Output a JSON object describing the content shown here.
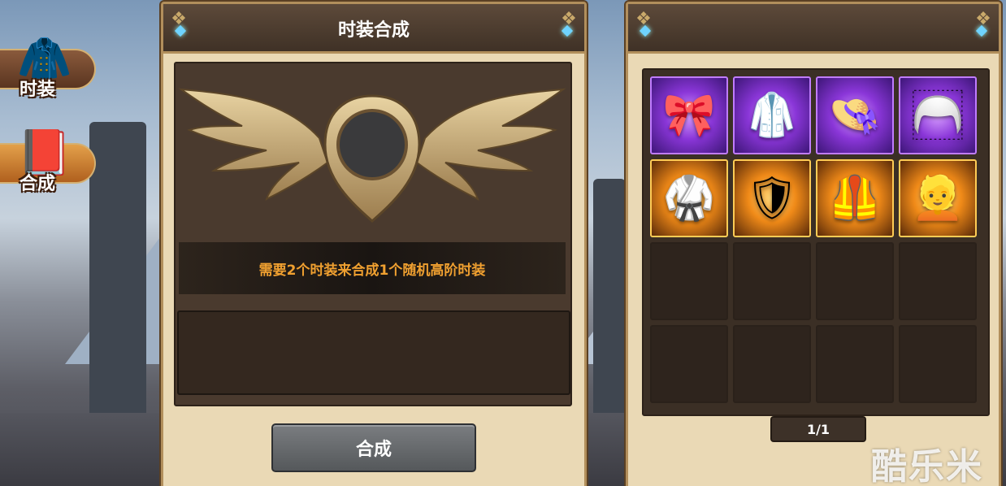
{
  "side_tabs": [
    {
      "label": "时装",
      "icon": "suit-icon",
      "glyph": "🧥",
      "active": false
    },
    {
      "label": "合成",
      "icon": "book-icon",
      "glyph": "📕",
      "active": true
    }
  ],
  "craft_panel": {
    "title": "时装合成",
    "hint": "需要2个时装来合成1个随机高阶时装",
    "button_label": "合成"
  },
  "inventory_panel": {
    "slots": [
      {
        "rarity": "purple",
        "icon": "bow-ribbon-icon",
        "glyph": "🎀"
      },
      {
        "rarity": "purple",
        "icon": "white-suit-icon",
        "glyph": "🥼"
      },
      {
        "rarity": "purple",
        "icon": "hat-icon",
        "glyph": "👒"
      },
      {
        "rarity": "purple",
        "icon": "white-wig-icon",
        "glyph": "🦳"
      },
      {
        "rarity": "orange",
        "icon": "gold-robe-icon",
        "glyph": "🥋"
      },
      {
        "rarity": "orange",
        "icon": "red-armor-icon",
        "glyph": "🛡"
      },
      {
        "rarity": "orange",
        "icon": "dark-armor-icon",
        "glyph": "🦺"
      },
      {
        "rarity": "orange",
        "icon": "white-hair-icon",
        "glyph": "👱"
      },
      {
        "rarity": "empty"
      },
      {
        "rarity": "empty"
      },
      {
        "rarity": "empty"
      },
      {
        "rarity": "empty"
      },
      {
        "rarity": "empty"
      },
      {
        "rarity": "empty"
      },
      {
        "rarity": "empty"
      },
      {
        "rarity": "empty"
      }
    ],
    "pager": "1/1"
  },
  "watermark": "酷乐米",
  "colors": {
    "panel_bg": "#ead9b5",
    "header_bg": "#4a3a2e",
    "hint_text": "#f0a030",
    "purple_rarity": "#8a36d8",
    "orange_rarity": "#f08a18"
  }
}
